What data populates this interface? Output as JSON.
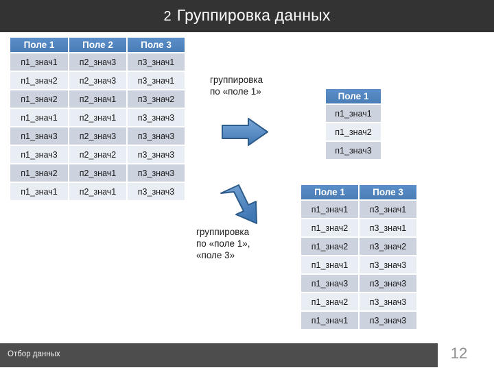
{
  "slide": {
    "title_number": "2",
    "title_text": "Группировка данных",
    "header_color": "#333333",
    "accent_color": "#4a7cb5"
  },
  "main_table": {
    "name": "source-data-table",
    "headers": [
      "Поле 1",
      "Поле 2",
      "Поле 3"
    ],
    "rows": [
      [
        "п1_знач1",
        "п2_знач3",
        "п3_знач1"
      ],
      [
        "п1_знач2",
        "п2_знач3",
        "п3_знач1"
      ],
      [
        "п1_знач2",
        "п2_знач1",
        "п3_знач2"
      ],
      [
        "п1_знач1",
        "п2_знач1",
        "п3_знач3"
      ],
      [
        "п1_знач3",
        "п2_знач3",
        "п3_знач3"
      ],
      [
        "п1_знач3",
        "п2_знач2",
        "п3_знач3"
      ],
      [
        "п1_знач2",
        "п2_знач1",
        "п3_знач3"
      ],
      [
        "п1_знач1",
        "п2_знач1",
        "п3_знач3"
      ]
    ]
  },
  "group1": {
    "caption": "группировка\nпо «поле 1»",
    "arrow": "right-arrow",
    "headers": [
      "Поле 1"
    ],
    "rows": [
      [
        "п1_знач1"
      ],
      [
        "п1_знач2"
      ],
      [
        "п1_знач3"
      ]
    ]
  },
  "group2": {
    "caption": "группировка\nпо «поле 1»,\n«поле 3»",
    "arrow": "diagonal-down-right-arrow",
    "headers": [
      "Поле 1",
      "Поле 3"
    ],
    "rows": [
      [
        "п1_знач1",
        "п3_знач1"
      ],
      [
        "п1_знач2",
        "п3_знач1"
      ],
      [
        "п1_знач2",
        "п3_знач2"
      ],
      [
        "п1_знач1",
        "п3_знач3"
      ],
      [
        "п1_знач3",
        "п3_знач3"
      ],
      [
        "п1_знач2",
        "п3_знач3"
      ],
      [
        "п1_знач1",
        "п3_знач3"
      ]
    ]
  },
  "footer": {
    "label": "Отбор данных",
    "page_number": "12"
  }
}
